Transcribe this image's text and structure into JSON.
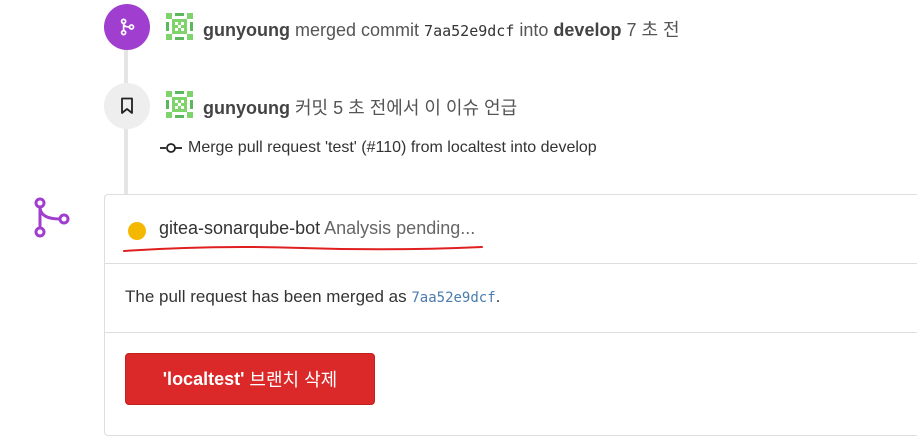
{
  "timeline": {
    "merge_event": {
      "user": "gunyoung",
      "action": "merged commit",
      "commit_hash": "7aa52e9dcf",
      "into": "into",
      "branch": "develop",
      "time": "7 초 전"
    },
    "ref_event": {
      "user": "gunyoung",
      "text": "커밋 5 초 전에서 이 이슈 언급",
      "commit_message": "Merge pull request 'test' (#110) from localtest into develop"
    }
  },
  "merge_box": {
    "bot_name": "gitea-sonarqube-bot",
    "status_text": "Analysis pending...",
    "status_color": "#f5b800",
    "merged_prefix": "The pull request has been merged as",
    "merged_hash": "7aa52e9dcf",
    "merged_suffix": ".",
    "delete_button": {
      "branch": "'localtest'",
      "label": "브랜치 삭제"
    }
  },
  "colors": {
    "merge_badge": "#a03fcf",
    "delete_button": "#db2828",
    "annotation_underline": "#e02020"
  },
  "icons": [
    "git-merge-icon",
    "bookmark-icon",
    "git-commit-icon",
    "avatar-identicon"
  ]
}
